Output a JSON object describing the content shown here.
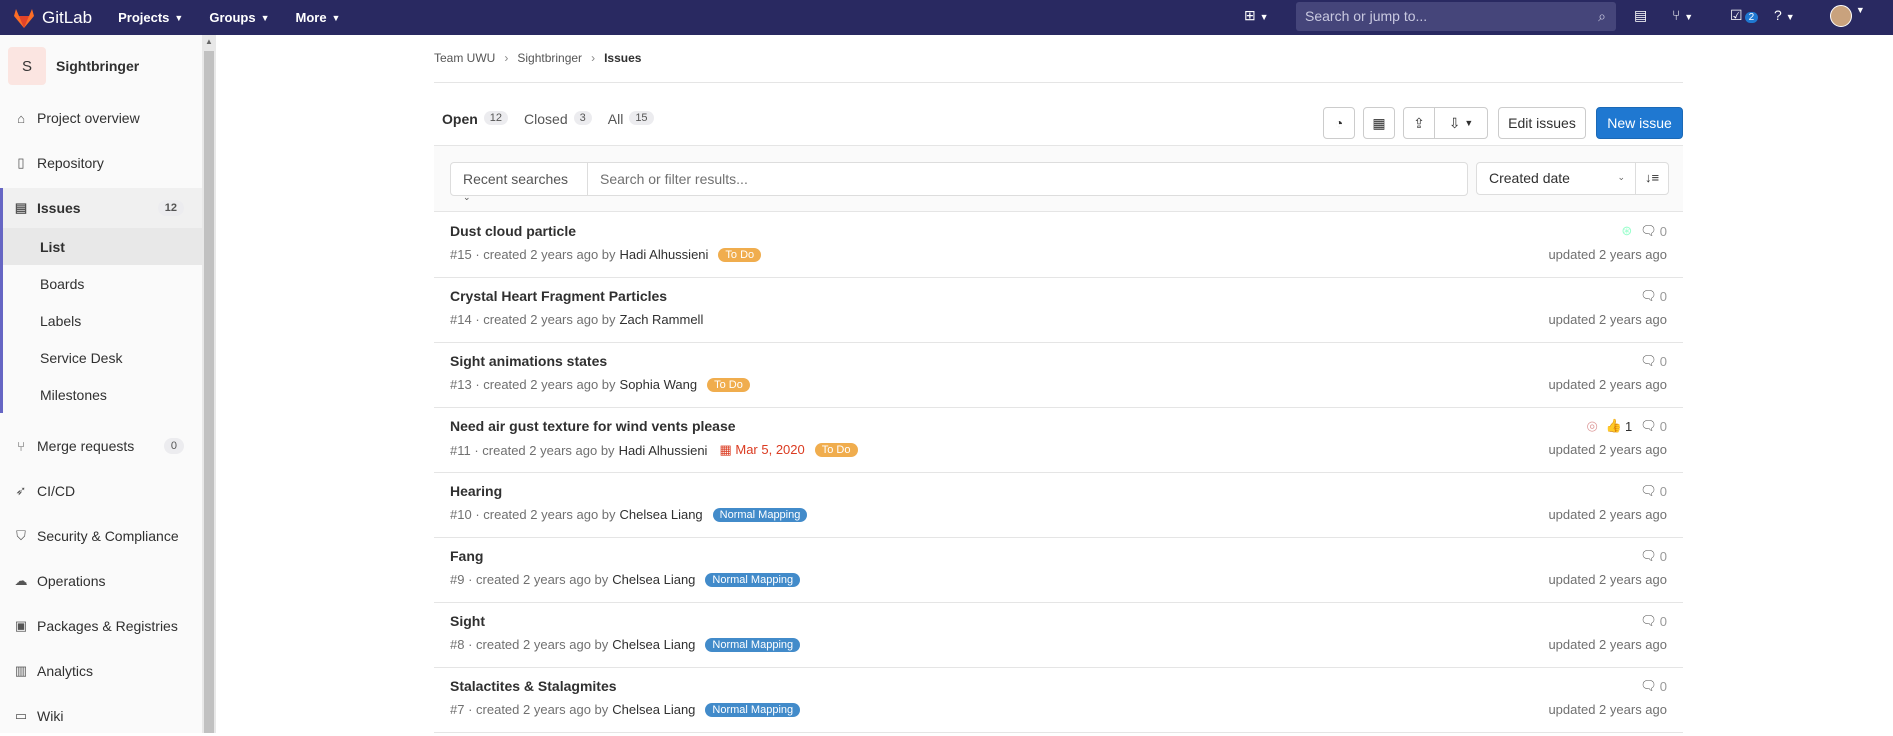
{
  "app": {
    "name": "GitLab"
  },
  "topnav": {
    "items": [
      "Projects",
      "Groups",
      "More"
    ],
    "search_placeholder": "Search or jump to...",
    "todos_count": "2"
  },
  "sidebar": {
    "project_initial": "S",
    "project_name": "Sightbringer",
    "items": [
      {
        "label": "Project overview",
        "icon": "home-icon"
      },
      {
        "label": "Repository",
        "icon": "doc-icon"
      },
      {
        "label": "Issues",
        "icon": "issues-icon",
        "count": "12"
      },
      {
        "label": "Merge requests",
        "icon": "merge-icon",
        "count": "0"
      },
      {
        "label": "CI/CD",
        "icon": "rocket-icon"
      },
      {
        "label": "Security & Compliance",
        "icon": "shield-icon"
      },
      {
        "label": "Operations",
        "icon": "cloud-icon"
      },
      {
        "label": "Packages & Registries",
        "icon": "package-icon"
      },
      {
        "label": "Analytics",
        "icon": "chart-icon"
      },
      {
        "label": "Wiki",
        "icon": "book-icon"
      }
    ],
    "subitems": [
      "List",
      "Boards",
      "Labels",
      "Service Desk",
      "Milestones"
    ]
  },
  "breadcrumb": [
    "Team UWU",
    "Sightbringer",
    "Issues"
  ],
  "tabs": [
    {
      "label": "Open",
      "count": "12"
    },
    {
      "label": "Closed",
      "count": "3"
    },
    {
      "label": "All",
      "count": "15"
    }
  ],
  "actions": {
    "edit": "Edit issues",
    "new": "New issue"
  },
  "filter": {
    "recent": "Recent searches",
    "placeholder": "Search or filter results...",
    "sort": "Created date"
  },
  "issues": [
    {
      "title": "Dust cloud particle",
      "ref": "#15",
      "created": "· created 2 years ago by",
      "author": "Hadi Alhussieni",
      "label": "To Do",
      "label_color": "#f0ad4e",
      "comments": "0",
      "updated": "updated 2 years ago"
    },
    {
      "title": "Crystal Heart Fragment Particles",
      "ref": "#14",
      "created": "· created 2 years ago by",
      "author": "Zach Rammell",
      "label": "",
      "label_color": "",
      "comments": "0",
      "updated": "updated 2 years ago"
    },
    {
      "title": "Sight animations states",
      "ref": "#13",
      "created": "· created 2 years ago by",
      "author": "Sophia Wang",
      "label": "To Do",
      "label_color": "#f0ad4e",
      "comments": "0",
      "updated": "updated 2 years ago"
    },
    {
      "title": "Need air gust texture for wind vents please",
      "ref": "#11",
      "created": "· created 2 years ago by",
      "author": "Hadi Alhussieni",
      "due": "Mar 5, 2020",
      "label": "To Do",
      "label_color": "#f0ad4e",
      "upvotes": "1",
      "comments": "0",
      "updated": "updated 2 years ago"
    },
    {
      "title": "Hearing",
      "ref": "#10",
      "created": "· created 2 years ago by",
      "author": "Chelsea Liang",
      "label": "Normal Mapping",
      "label_color": "#428bca",
      "comments": "0",
      "updated": "updated 2 years ago"
    },
    {
      "title": "Fang",
      "ref": "#9",
      "created": "· created 2 years ago by",
      "author": "Chelsea Liang",
      "label": "Normal Mapping",
      "label_color": "#428bca",
      "comments": "0",
      "updated": "updated 2 years ago"
    },
    {
      "title": "Sight",
      "ref": "#8",
      "created": "· created 2 years ago by",
      "author": "Chelsea Liang",
      "label": "Normal Mapping",
      "label_color": "#428bca",
      "comments": "0",
      "updated": "updated 2 years ago"
    },
    {
      "title": "Stalactites & Stalagmites",
      "ref": "#7",
      "created": "· created 2 years ago by",
      "author": "Chelsea Liang",
      "label": "Normal Mapping",
      "label_color": "#428bca",
      "comments": "0",
      "updated": "updated 2 years ago"
    }
  ]
}
